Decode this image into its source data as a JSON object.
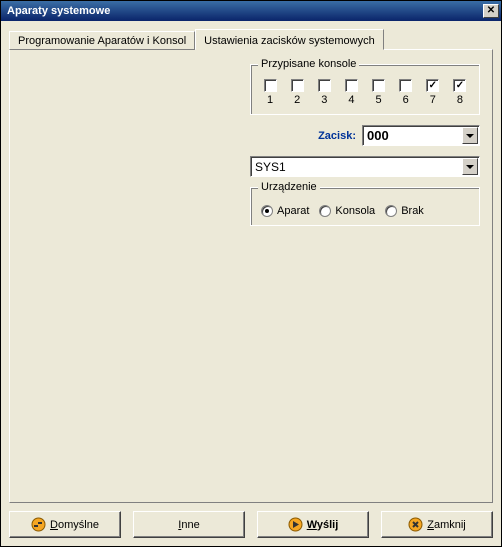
{
  "window": {
    "title": "Aparaty systemowe"
  },
  "tabs": [
    {
      "label": "Programowanie Aparatów i Konsol",
      "active": false
    },
    {
      "label": "Ustawienia zacisków systemowych",
      "active": true
    }
  ],
  "consoles": {
    "group_title": "Przypisane konsole",
    "items": [
      {
        "num": "1",
        "checked": false
      },
      {
        "num": "2",
        "checked": false
      },
      {
        "num": "3",
        "checked": false
      },
      {
        "num": "4",
        "checked": false
      },
      {
        "num": "5",
        "checked": false
      },
      {
        "num": "6",
        "checked": false
      },
      {
        "num": "7",
        "checked": true
      },
      {
        "num": "8",
        "checked": true
      }
    ]
  },
  "zacisk": {
    "label": "Zacisk:",
    "value": "000"
  },
  "sys_field": {
    "value": "SYS1"
  },
  "device": {
    "group_title": "Urządzenie",
    "options": [
      {
        "label": "Aparat",
        "selected": true
      },
      {
        "label": "Konsola",
        "selected": false
      },
      {
        "label": "Brak",
        "selected": false
      }
    ]
  },
  "buttons": {
    "defaults": "Domyślne",
    "other": "Inne",
    "send": "Wyślij",
    "close": "Zamknij"
  }
}
